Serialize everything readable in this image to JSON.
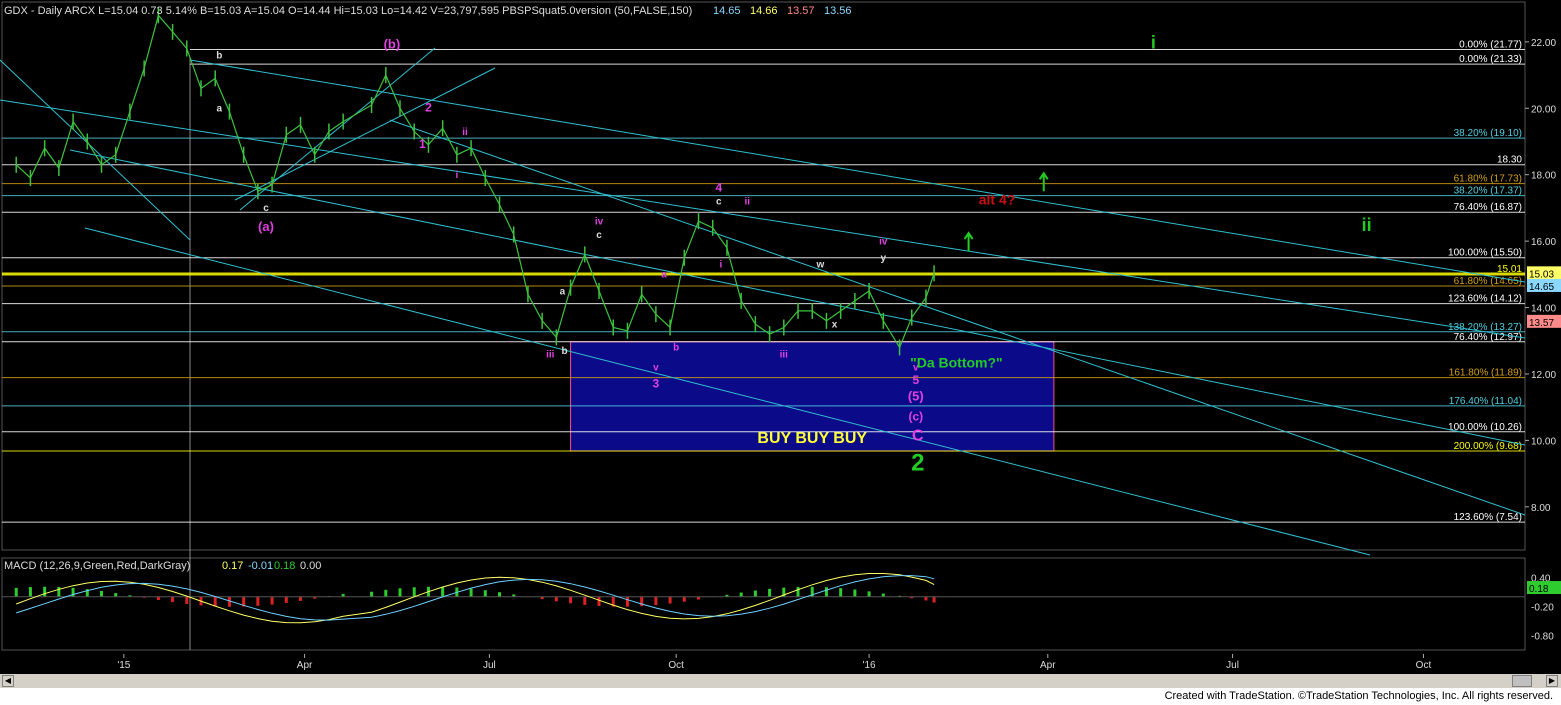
{
  "header": {
    "symbol_line": "GDX - Daily  ARCX  L=15.04  0.73  5.14%  B=15.03  A=15.04  O=14.44  Hi=15.03  Lo=14.42  V=23,797,595  PBSPSquat5.0version (50,FALSE,150)",
    "indicator_values": [
      "14.65",
      "14.66",
      "13.57",
      "13.56"
    ]
  },
  "macd_header": {
    "label": "MACD (12,26,9,Green,Red,DarkGray)",
    "values": [
      "0.17",
      "-0.01",
      "0.18",
      "0.00"
    ]
  },
  "footer": {
    "credit": "Created with TradeStation. ©TradeStation Technologies, Inc. All rights reserved."
  },
  "chart_data": {
    "type": "line",
    "title": "GDX - Daily",
    "price_axis": {
      "ticks": [
        8.0,
        10.0,
        12.0,
        14.0,
        16.0,
        18.0,
        20.0,
        22.0
      ],
      "range": [
        6.7,
        23.2
      ]
    },
    "macd_axis": {
      "ticks": [
        0.4,
        -0.2,
        -0.8
      ],
      "range": [
        -1.1,
        0.8
      ]
    },
    "x_ticks": [
      "'15",
      "Apr",
      "Jul",
      "Oct",
      "'16",
      "Apr",
      "Jul",
      "Oct"
    ],
    "last_price_labels": [
      {
        "text": "15.03",
        "value": 15.03,
        "color": "#ffff66"
      },
      {
        "text": "14.65",
        "value": 14.65,
        "color": "#8ad7ff"
      },
      {
        "text": "13.57",
        "value": 13.57,
        "color": "#ff8a8a"
      }
    ],
    "macd_last_label": "0.18",
    "price_series": [
      [
        "2014-11-10",
        18.3
      ],
      [
        "2014-11-17",
        17.9
      ],
      [
        "2014-11-24",
        18.8
      ],
      [
        "2014-12-01",
        18.2
      ],
      [
        "2014-12-08",
        19.6
      ],
      [
        "2014-12-15",
        19.0
      ],
      [
        "2014-12-22",
        18.3
      ],
      [
        "2014-12-29",
        18.6
      ],
      [
        "2015-01-05",
        19.9
      ],
      [
        "2015-01-12",
        21.2
      ],
      [
        "2015-01-19",
        22.8
      ],
      [
        "2015-01-26",
        22.3
      ],
      [
        "2015-02-02",
        21.8
      ],
      [
        "2015-02-09",
        20.6
      ],
      [
        "2015-02-16",
        20.9
      ],
      [
        "2015-02-23",
        19.9
      ],
      [
        "2015-03-02",
        18.6
      ],
      [
        "2015-03-09",
        17.5
      ],
      [
        "2015-03-16",
        17.7
      ],
      [
        "2015-03-23",
        19.2
      ],
      [
        "2015-03-30",
        19.5
      ],
      [
        "2015-04-06",
        18.6
      ],
      [
        "2015-04-13",
        19.3
      ],
      [
        "2015-04-20",
        19.6
      ],
      [
        "2015-05-04",
        20.1
      ],
      [
        "2015-05-11",
        21.0
      ],
      [
        "2015-05-18",
        20.0
      ],
      [
        "2015-05-25",
        19.3
      ],
      [
        "2015-06-01",
        18.9
      ],
      [
        "2015-06-08",
        19.4
      ],
      [
        "2015-06-15",
        18.6
      ],
      [
        "2015-06-22",
        18.8
      ],
      [
        "2015-06-29",
        17.9
      ],
      [
        "2015-07-06",
        17.1
      ],
      [
        "2015-07-13",
        16.2
      ],
      [
        "2015-07-20",
        14.4
      ],
      [
        "2015-07-27",
        13.6
      ],
      [
        "2015-08-03",
        13.1
      ],
      [
        "2015-08-10",
        14.6
      ],
      [
        "2015-08-17",
        15.6
      ],
      [
        "2015-08-24",
        14.5
      ],
      [
        "2015-08-31",
        13.4
      ],
      [
        "2015-09-07",
        13.3
      ],
      [
        "2015-09-14",
        14.4
      ],
      [
        "2015-09-21",
        13.8
      ],
      [
        "2015-09-28",
        13.4
      ],
      [
        "2015-10-05",
        15.5
      ],
      [
        "2015-10-12",
        16.6
      ],
      [
        "2015-10-19",
        16.4
      ],
      [
        "2015-10-26",
        15.8
      ],
      [
        "2015-11-02",
        14.2
      ],
      [
        "2015-11-09",
        13.5
      ],
      [
        "2015-11-16",
        13.2
      ],
      [
        "2015-11-23",
        13.4
      ],
      [
        "2015-11-30",
        13.9
      ],
      [
        "2015-12-07",
        13.9
      ],
      [
        "2015-12-14",
        13.6
      ],
      [
        "2015-12-21",
        13.9
      ],
      [
        "2015-12-28",
        14.2
      ],
      [
        "2016-01-04",
        14.5
      ],
      [
        "2016-01-11",
        13.6
      ],
      [
        "2016-01-19",
        12.8
      ],
      [
        "2016-01-25",
        13.7
      ],
      [
        "2016-02-01",
        14.3
      ],
      [
        "2016-02-05",
        15.03
      ]
    ],
    "horizontal_levels": [
      {
        "value": 21.77,
        "label": "0.00% (21.77)",
        "color": "#ffffff"
      },
      {
        "value": 21.33,
        "label": "0.00% (21.33)",
        "color": "#ffffff"
      },
      {
        "value": 19.1,
        "label": "38.20% (19.10)",
        "color": "#50d0e0"
      },
      {
        "value": 18.3,
        "label": "18.30",
        "color": "#ffffff"
      },
      {
        "value": 17.73,
        "label": "61.80% (17.73)",
        "color": "#d4a017"
      },
      {
        "value": 17.37,
        "label": "38.20% (17.37)",
        "color": "#50d0e0"
      },
      {
        "value": 16.87,
        "label": "76.40% (16.87)",
        "color": "#ffffff"
      },
      {
        "value": 15.5,
        "label": "100.00% (15.50)",
        "color": "#ffffff"
      },
      {
        "value": 15.01,
        "label": "15.01",
        "color": "#ffff00"
      },
      {
        "value": 14.65,
        "label": "61.80% (14.65)",
        "color": "#d4a017"
      },
      {
        "value": 14.12,
        "label": "123.60% (14.12)",
        "color": "#ffffff"
      },
      {
        "value": 13.27,
        "label": "138.20% (13.27)",
        "color": "#50d0e0"
      },
      {
        "value": 12.97,
        "label": "76.40% (12.97)",
        "color": "#ffffff"
      },
      {
        "value": 11.89,
        "label": "161.80% (11.89)",
        "color": "#d4a017"
      },
      {
        "value": 11.04,
        "label": "176.40% (11.04)",
        "color": "#50d0e0"
      },
      {
        "value": 10.26,
        "label": "100.00% (10.26)",
        "color": "#ffffff"
      },
      {
        "value": 9.68,
        "label": "200.00% (9.68)",
        "color": "#ffff00"
      },
      {
        "value": 7.54,
        "label": "123.60% (7.54)",
        "color": "#ffffff"
      }
    ],
    "buy_zone": {
      "from": "2015-08-10",
      "to": "2016-04-04",
      "low": 9.68,
      "high": 12.97,
      "label": "BUY  BUY  BUY"
    },
    "annotations": [
      {
        "text": "(b)",
        "date": "2015-05-14",
        "price": 21.8,
        "color": "#e040e0",
        "size": 13
      },
      {
        "text": "(a)",
        "date": "2015-03-13",
        "price": 16.3,
        "color": "#e040e0",
        "size": 13
      },
      {
        "text": "b",
        "date": "2015-02-18",
        "price": 21.5,
        "color": "#dddddd",
        "size": 10
      },
      {
        "text": "a",
        "date": "2015-02-18",
        "price": 19.9,
        "color": "#dddddd",
        "size": 10
      },
      {
        "text": "c",
        "date": "2015-03-13",
        "price": 16.9,
        "color": "#dddddd",
        "size": 10
      },
      {
        "text": "2",
        "date": "2015-06-01",
        "price": 19.9,
        "color": "#e040e0",
        "size": 12
      },
      {
        "text": "1",
        "date": "2015-05-29",
        "price": 18.8,
        "color": "#e040e0",
        "size": 12
      },
      {
        "text": "ii",
        "date": "2015-06-19",
        "price": 19.2,
        "color": "#e040e0",
        "size": 10
      },
      {
        "text": "i",
        "date": "2015-06-15",
        "price": 17.9,
        "color": "#e040e0",
        "size": 10
      },
      {
        "text": "iv",
        "date": "2015-08-24",
        "price": 16.5,
        "color": "#e040e0",
        "size": 10
      },
      {
        "text": "c",
        "date": "2015-08-24",
        "price": 16.1,
        "color": "#dddddd",
        "size": 10
      },
      {
        "text": "a",
        "date": "2015-08-06",
        "price": 14.4,
        "color": "#dddddd",
        "size": 10
      },
      {
        "text": "iii",
        "date": "2015-07-31",
        "price": 12.5,
        "color": "#e040e0",
        "size": 10
      },
      {
        "text": "b",
        "date": "2015-08-07",
        "price": 12.6,
        "color": "#dddddd",
        "size": 10
      },
      {
        "text": "a",
        "date": "2015-09-25",
        "price": 14.9,
        "color": "#e040e0",
        "size": 10
      },
      {
        "text": "b",
        "date": "2015-10-01",
        "price": 12.7,
        "color": "#e040e0",
        "size": 10
      },
      {
        "text": "v",
        "date": "2015-09-21",
        "price": 12.1,
        "color": "#e040e0",
        "size": 10
      },
      {
        "text": "3",
        "date": "2015-09-21",
        "price": 11.6,
        "color": "#e040e0",
        "size": 12
      },
      {
        "text": "4",
        "date": "2015-10-22",
        "price": 17.5,
        "color": "#e040e0",
        "size": 12
      },
      {
        "text": "c",
        "date": "2015-10-22",
        "price": 17.1,
        "color": "#dddddd",
        "size": 10
      },
      {
        "text": "ii",
        "date": "2015-11-05",
        "price": 17.1,
        "color": "#e040e0",
        "size": 10
      },
      {
        "text": "i",
        "date": "2015-10-23",
        "price": 15.2,
        "color": "#e040e0",
        "size": 10
      },
      {
        "text": "w",
        "date": "2015-12-11",
        "price": 15.2,
        "color": "#dddddd",
        "size": 10
      },
      {
        "text": "iii",
        "date": "2015-11-23",
        "price": 12.5,
        "color": "#e040e0",
        "size": 10
      },
      {
        "text": "x",
        "date": "2015-12-18",
        "price": 13.4,
        "color": "#dddddd",
        "size": 10
      },
      {
        "text": "iv",
        "date": "2016-01-11",
        "price": 15.9,
        "color": "#e040e0",
        "size": 10
      },
      {
        "text": "y",
        "date": "2016-01-11",
        "price": 15.4,
        "color": "#dddddd",
        "size": 10
      },
      {
        "text": "v",
        "date": "2016-01-27",
        "price": 12.1,
        "color": "#e040e0",
        "size": 10
      },
      {
        "text": "5",
        "date": "2016-01-27",
        "price": 11.7,
        "color": "#e040e0",
        "size": 12
      },
      {
        "text": "(5)",
        "date": "2016-01-27",
        "price": 11.2,
        "color": "#e040e0",
        "size": 13
      },
      {
        "text": "(c)",
        "date": "2016-01-27",
        "price": 10.6,
        "color": "#e040e0",
        "size": 12
      },
      {
        "text": "C",
        "date": "2016-01-28",
        "price": 10.0,
        "color": "#e040e0",
        "size": 16
      },
      {
        "text": "2",
        "date": "2016-01-28",
        "price": 9.1,
        "color": "#22cc22",
        "size": 24
      },
      {
        "text": "\"Da Bottom?\"",
        "date": "2016-02-16",
        "price": 12.2,
        "color": "#22cc22",
        "size": 14
      },
      {
        "text": "alt 4?",
        "date": "2016-03-07",
        "price": 17.1,
        "color": "#cc1111",
        "size": 14
      },
      {
        "text": "i",
        "date": "2016-05-23",
        "price": 21.8,
        "color": "#22cc22",
        "size": 18
      },
      {
        "text": "ii",
        "date": "2016-09-05",
        "price": 16.3,
        "color": "#22cc22",
        "size": 18
      }
    ],
    "arrows": [
      {
        "date": "2016-02-22",
        "price": 15.7,
        "color": "#22cc22"
      },
      {
        "date": "2016-03-30",
        "price": 17.5,
        "color": "#22cc22"
      }
    ]
  }
}
